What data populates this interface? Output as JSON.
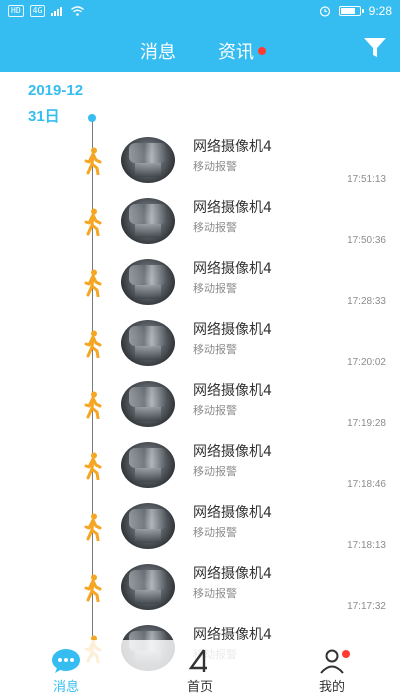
{
  "status_bar": {
    "left_chips": [
      "HD",
      "4G"
    ],
    "time": "9:28",
    "battery_level": 0.85
  },
  "header": {
    "tabs": [
      {
        "label": "消息",
        "active": true
      },
      {
        "label": "资讯",
        "active": false,
        "badge": true
      }
    ],
    "filter_icon": "filter-icon"
  },
  "timeline": {
    "year_month": "2019-12",
    "day": "31日"
  },
  "events": [
    {
      "title": "网络摄像机4",
      "subtitle": "移动报警",
      "time": "17:51:13"
    },
    {
      "title": "网络摄像机4",
      "subtitle": "移动报警",
      "time": "17:50:36"
    },
    {
      "title": "网络摄像机4",
      "subtitle": "移动报警",
      "time": "17:28:33"
    },
    {
      "title": "网络摄像机4",
      "subtitle": "移动报警",
      "time": "17:20:02"
    },
    {
      "title": "网络摄像机4",
      "subtitle": "移动报警",
      "time": "17:19:28"
    },
    {
      "title": "网络摄像机4",
      "subtitle": "移动报警",
      "time": "17:18:46"
    },
    {
      "title": "网络摄像机4",
      "subtitle": "移动报警",
      "time": "17:18:13"
    },
    {
      "title": "网络摄像机4",
      "subtitle": "移动报警",
      "time": "17:17:32"
    },
    {
      "title": "网络摄像机4",
      "subtitle": "移动报警",
      "time": ""
    }
  ],
  "bottom_nav": {
    "items": [
      {
        "label": "消息",
        "icon": "chat-bubble-icon",
        "active": true
      },
      {
        "label": "首页",
        "icon": "home-logo-icon",
        "active": false
      },
      {
        "label": "我的",
        "icon": "user-icon",
        "active": false,
        "badge": true
      }
    ]
  },
  "colors": {
    "primary": "#35bdf1",
    "alert_red": "#ff3b30",
    "walker_orange": "#f5a623"
  }
}
